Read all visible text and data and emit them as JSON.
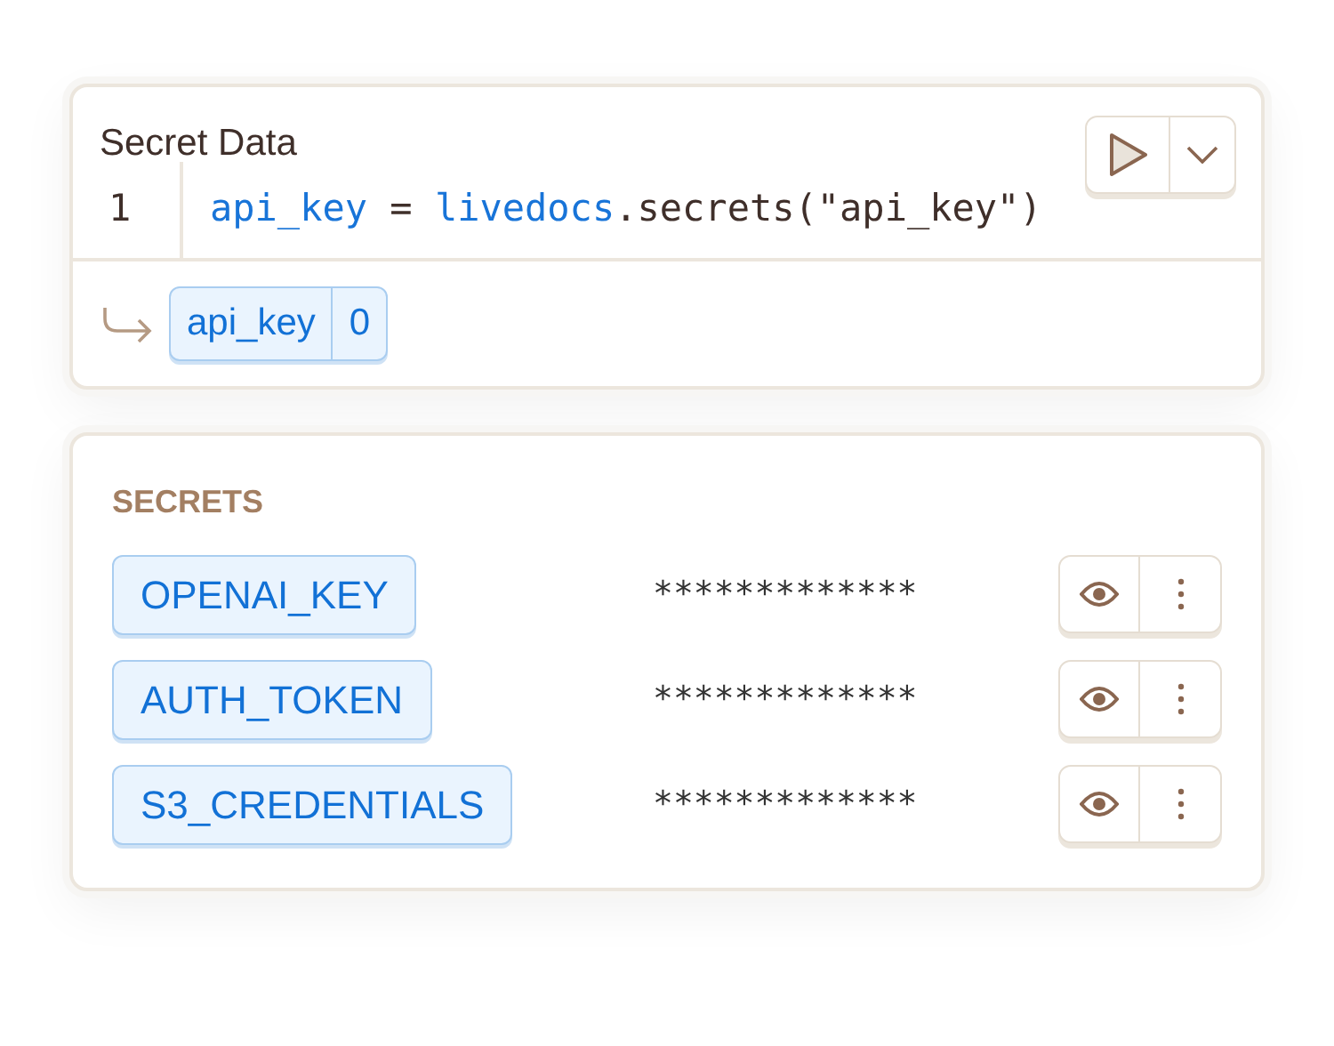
{
  "cell": {
    "title": "Secret Data",
    "line_number": "1",
    "code": [
      {
        "kind": "name",
        "text": "api_key"
      },
      {
        "kind": "plain",
        "text": " = "
      },
      {
        "kind": "name",
        "text": "livedocs"
      },
      {
        "kind": "plain",
        "text": ".secrets(\"api_key\")"
      }
    ],
    "output": {
      "name": "api_key",
      "value": "0"
    }
  },
  "secrets": {
    "heading": "SECRETS",
    "items": [
      {
        "name": "OPENAI_KEY",
        "value": "*************"
      },
      {
        "name": "AUTH_TOKEN",
        "value": "*************"
      },
      {
        "name": "S3_CREDENTIALS",
        "value": "*************"
      }
    ]
  }
}
